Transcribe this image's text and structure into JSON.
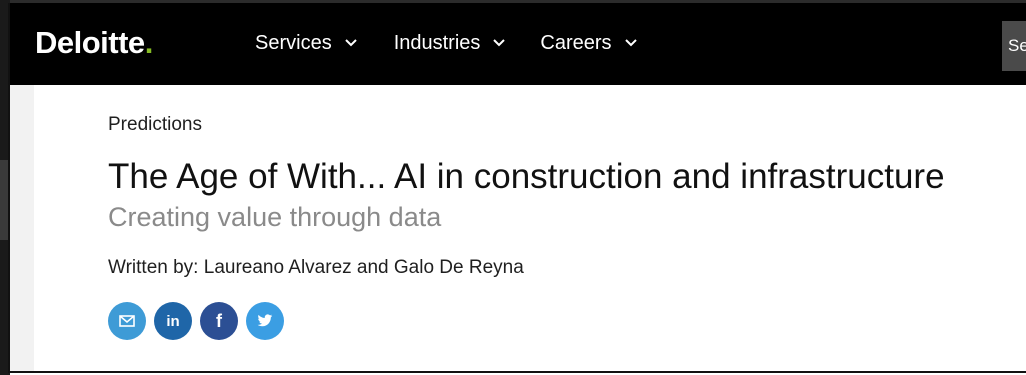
{
  "header": {
    "logo_text": "Deloitte",
    "logo_dot": ".",
    "nav": [
      {
        "label": "Services"
      },
      {
        "label": "Industries"
      },
      {
        "label": "Careers"
      }
    ],
    "search_stub": "Se"
  },
  "article": {
    "category": "Predictions",
    "title": "The Age of With... AI in construction and infrastructure",
    "subtitle": "Creating value through data",
    "byline_prefix": "Written by:",
    "authors": "Laureano Alvarez and Galo De Reyna"
  },
  "social": [
    {
      "name": "email",
      "icon": "envelope-icon",
      "color": "#3e9bd6"
    },
    {
      "name": "linkedin",
      "label": "in",
      "icon": "linkedin-icon",
      "color": "#1f66a8"
    },
    {
      "name": "facebook",
      "label": "f",
      "icon": "facebook-icon",
      "color": "#2c4f94"
    },
    {
      "name": "twitter",
      "icon": "twitter-icon",
      "color": "#3b9ee3"
    }
  ],
  "colors": {
    "header_bg": "#000000",
    "brand_green": "#86BC25",
    "subtitle_gray": "#8a8a8a"
  }
}
